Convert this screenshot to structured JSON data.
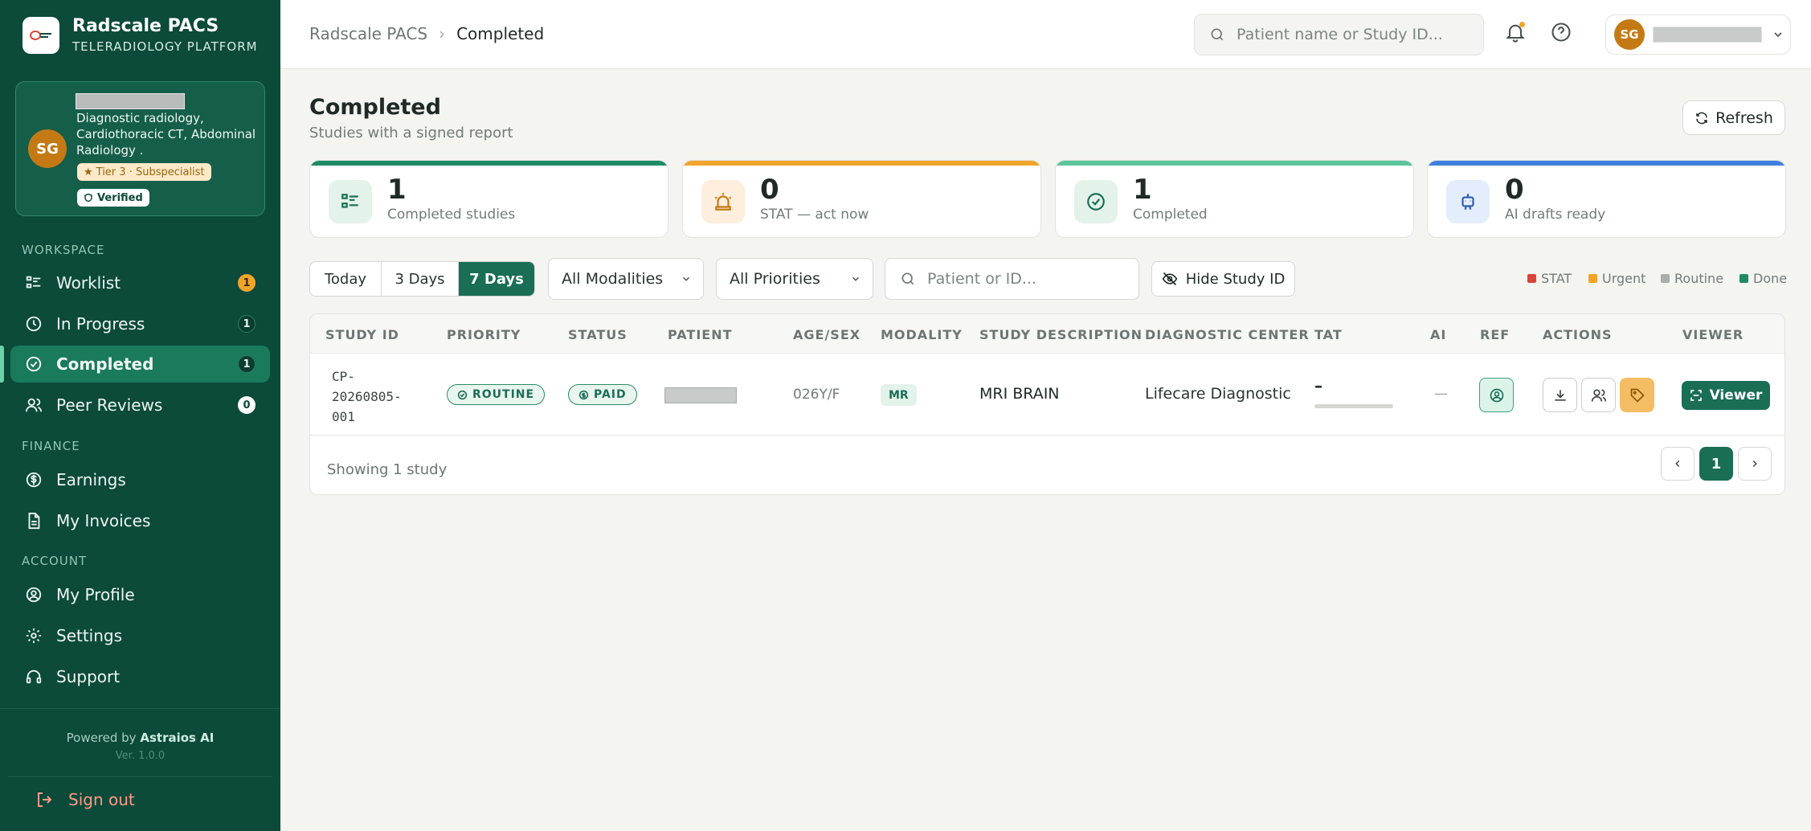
{
  "brand": {
    "title": "Radscale PACS",
    "subtitle": "TELERADIOLOGY PLATFORM"
  },
  "profile": {
    "initials": "SG",
    "specialties": "Diagnostic radiology, Cardiothoracic CT, Abdominal Radiology .",
    "tier": "Tier 3 · Subspecialist",
    "verified": "Verified"
  },
  "sidebar": {
    "workspace_label": "WORKSPACE",
    "finance_label": "FINANCE",
    "account_label": "ACCOUNT",
    "workspace": [
      {
        "label": "Worklist",
        "icon": "list-icon",
        "badge": "1",
        "badge_style": "orange"
      },
      {
        "label": "In Progress",
        "icon": "clock-icon",
        "badge": "1",
        "badge_style": "dark"
      },
      {
        "label": "Completed",
        "icon": "check-circle-icon",
        "badge": "1",
        "badge_style": "dark",
        "active": true
      },
      {
        "label": "Peer Reviews",
        "icon": "users-icon",
        "badge": "0",
        "badge_style": "white"
      }
    ],
    "finance": [
      {
        "label": "Earnings",
        "icon": "dollar-circle-icon"
      },
      {
        "label": "My Invoices",
        "icon": "document-icon"
      }
    ],
    "account": [
      {
        "label": "My Profile",
        "icon": "user-circle-icon"
      },
      {
        "label": "Settings",
        "icon": "gear-icon"
      },
      {
        "label": "Support",
        "icon": "headset-icon"
      }
    ],
    "powered_prefix": "Powered by",
    "powered_brand": "Astraios AI",
    "version": "Ver. 1.0.0",
    "signout": "Sign out"
  },
  "topbar": {
    "breadcrumb_root": "Radscale PACS",
    "breadcrumb_sep": "›",
    "breadcrumb_current": "Completed",
    "search_placeholder": "Patient name or Study ID...",
    "user_initials": "SG"
  },
  "page": {
    "title": "Completed",
    "subtitle": "Studies with a signed report",
    "refresh_label": "Refresh"
  },
  "stats": [
    {
      "value": "1",
      "label": "Completed studies",
      "stripe": "#1f8a66",
      "icon": "list-icon",
      "icon_bg": "#e3f3ea",
      "icon_color": "#1a6e55"
    },
    {
      "value": "0",
      "label": "STAT — act now",
      "stripe": "#f0a52a",
      "icon": "siren-icon",
      "icon_bg": "#fdeedd",
      "icon_color": "#c47a14"
    },
    {
      "value": "1",
      "label": "Completed",
      "stripe": "#5cc49a",
      "icon": "check-circle-icon",
      "icon_bg": "#e3f3ea",
      "icon_color": "#1a6e55"
    },
    {
      "value": "0",
      "label": "AI drafts ready",
      "stripe": "#3f7fe0",
      "icon": "robot-icon",
      "icon_bg": "#e4edfb",
      "icon_color": "#2a5fb0"
    }
  ],
  "filters": {
    "ranges": [
      "Today",
      "3 Days",
      "7 Days"
    ],
    "active_range": "7 Days",
    "modality": "All Modalities",
    "priority": "All Priorities",
    "search_placeholder": "Patient or ID...",
    "hide_label": "Hide Study ID",
    "legend": [
      {
        "label": "STAT",
        "color": "#d9453a"
      },
      {
        "label": "Urgent",
        "color": "#f0a52a"
      },
      {
        "label": "Routine",
        "color": "#a9adab"
      },
      {
        "label": "Done",
        "color": "#1f8a66"
      }
    ]
  },
  "table": {
    "columns": [
      "STUDY ID",
      "PRIORITY",
      "STATUS",
      "PATIENT",
      "AGE/SEX",
      "MODALITY",
      "STUDY DESCRIPTION",
      "DIAGNOSTIC CENTER",
      "TAT",
      "AI",
      "REF",
      "ACTIONS",
      "VIEWER"
    ],
    "rows": [
      {
        "study_id": "CP-20260805-001",
        "priority": "ROUTINE",
        "status": "PAID",
        "age_sex": "026Y/F",
        "modality": "MR",
        "description": "MRI BRAIN",
        "center": "Lifecare Diagnostic",
        "tat": "–",
        "ai": "—",
        "viewer_label": "Viewer"
      }
    ],
    "showing": "Showing 1 study",
    "page": "1"
  }
}
